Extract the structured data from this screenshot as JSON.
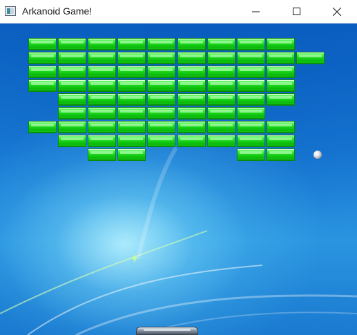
{
  "window": {
    "title": "Arkanoid Game!",
    "icon": "app-window-icon",
    "controls": [
      "minimize-icon",
      "maximize-icon",
      "close-icon"
    ]
  },
  "game": {
    "brick_color": "#1ed81e",
    "background": "windows-7-blue-wallpaper",
    "bricks": [
      [
        1,
        1,
        1,
        1,
        1,
        1,
        1,
        1,
        1,
        0
      ],
      [
        1,
        1,
        1,
        1,
        1,
        1,
        1,
        1,
        1,
        1
      ],
      [
        1,
        1,
        1,
        1,
        1,
        1,
        1,
        1,
        1,
        0
      ],
      [
        1,
        1,
        1,
        1,
        1,
        1,
        1,
        1,
        1,
        0
      ],
      [
        0,
        1,
        1,
        1,
        1,
        1,
        1,
        1,
        1,
        0
      ],
      [
        0,
        1,
        1,
        1,
        1,
        1,
        1,
        1,
        0,
        0
      ],
      [
        1,
        1,
        1,
        1,
        1,
        1,
        1,
        1,
        1,
        0
      ],
      [
        0,
        1,
        1,
        1,
        1,
        1,
        1,
        1,
        1,
        0
      ],
      [
        0,
        0,
        1,
        1,
        0,
        0,
        0,
        1,
        1,
        0
      ]
    ],
    "ball": "silver-ball",
    "paddle": "metal-paddle"
  }
}
